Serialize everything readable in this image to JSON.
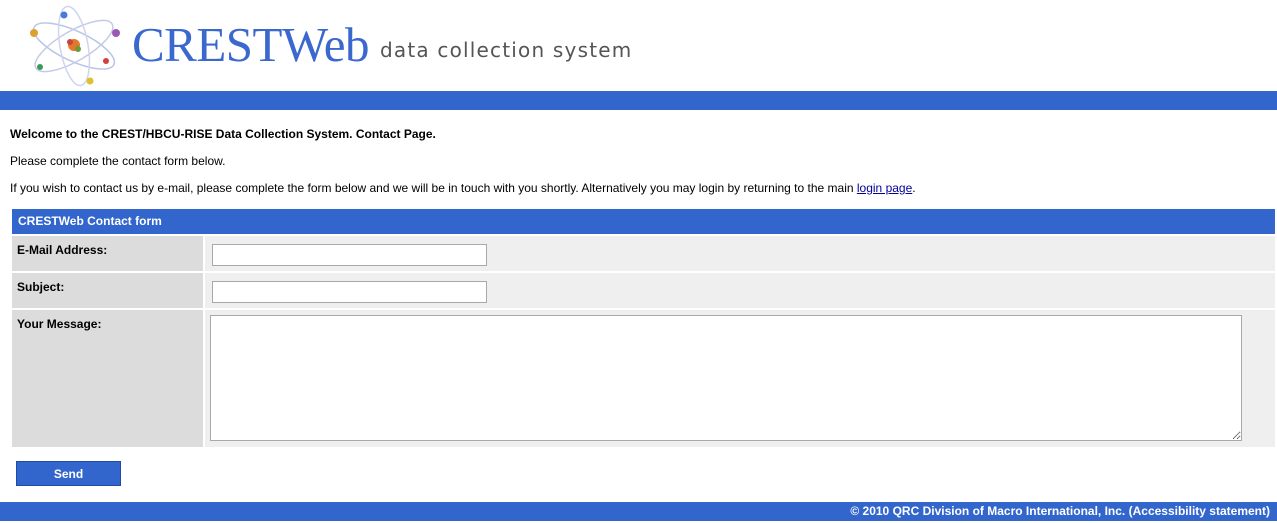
{
  "header": {
    "brand": "CRESTWeb",
    "tagline": "data collection system"
  },
  "intro": {
    "welcome": "Welcome to the CREST/HBCU-RISE Data Collection System. Contact Page.",
    "instruction": "Please complete the contact form below.",
    "contact_text": "If you wish to contact us by e-mail, please complete the form below and we will be in touch with you shortly. Alternatively you may login by returning to the main ",
    "login_link": "login page",
    "contact_text_end": "."
  },
  "form": {
    "title": "CRESTWeb Contact form",
    "email_label": "E-Mail Address:",
    "email_value": "",
    "subject_label": "Subject:",
    "subject_value": "",
    "message_label": "Your Message:",
    "message_value": "",
    "send_label": "Send"
  },
  "footer": {
    "copyright": "© 2010 QRC Division of Macro International, Inc.",
    "accessibility_link": "(Accessibility statement)"
  },
  "colors": {
    "brand_blue": "#3366cc",
    "logo_text": "#3a68cf",
    "label_bg": "#dcdcdc",
    "field_bg": "#efefef"
  }
}
